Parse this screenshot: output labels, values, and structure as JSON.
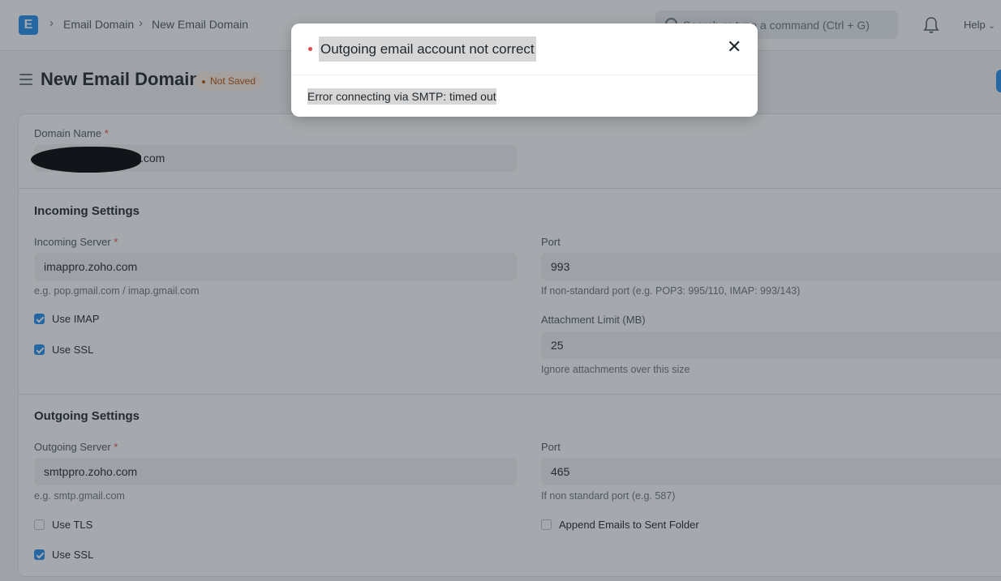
{
  "navbar": {
    "logo": "E",
    "breadcrumbs": [
      "Email Domain",
      "New Email Domain"
    ],
    "search_placeholder": "Search or type a command (Ctrl + G)",
    "help_label": "Help"
  },
  "page": {
    "title": "New Email Domain",
    "status_badge": "Not Saved"
  },
  "form": {
    "domain_name": {
      "label": "Domain Name",
      "value": ".com"
    },
    "incoming": {
      "title": "Incoming Settings",
      "server": {
        "label": "Incoming Server",
        "value": "imappro.zoho.com",
        "help": "e.g. pop.gmail.com / imap.gmail.com"
      },
      "port": {
        "label": "Port",
        "value": "993",
        "help": "If non-standard port (e.g. POP3: 995/110, IMAP: 993/143)"
      },
      "use_imap": {
        "label": "Use IMAP",
        "checked": true
      },
      "use_ssl": {
        "label": "Use SSL",
        "checked": true
      },
      "attachment_limit": {
        "label": "Attachment Limit (MB)",
        "value": "25",
        "help": "Ignore attachments over this size"
      }
    },
    "outgoing": {
      "title": "Outgoing Settings",
      "server": {
        "label": "Outgoing Server",
        "value": "smtppro.zoho.com",
        "help": "e.g. smtp.gmail.com"
      },
      "port": {
        "label": "Port",
        "value": "465",
        "help": "If non standard port (e.g. 587)"
      },
      "use_tls": {
        "label": "Use TLS",
        "checked": false
      },
      "append_sent": {
        "label": "Append Emails to Sent Folder",
        "checked": false
      },
      "use_ssl": {
        "label": "Use SSL",
        "checked": true
      }
    }
  },
  "modal": {
    "title": "Outgoing email account not correct",
    "message": "Error connecting via SMTP: timed out"
  },
  "colors": {
    "primary": "#2490ef",
    "error": "#e24c4c",
    "badge": "#b45309"
  }
}
